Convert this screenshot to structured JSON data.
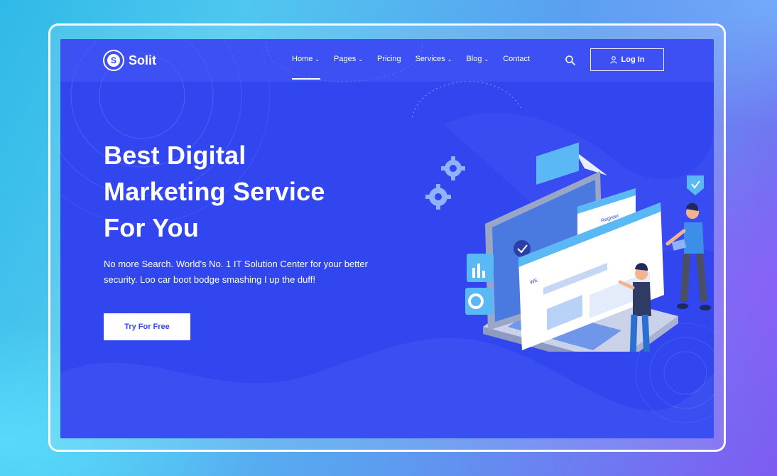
{
  "brand": {
    "name": "Solit",
    "logo_letter": "S"
  },
  "nav": {
    "items": [
      {
        "label": "Home",
        "dropdown": true,
        "active": true
      },
      {
        "label": "Pages",
        "dropdown": true,
        "active": false
      },
      {
        "label": "Pricing",
        "dropdown": false,
        "active": false
      },
      {
        "label": "Services",
        "dropdown": true,
        "active": false
      },
      {
        "label": "Blog",
        "dropdown": true,
        "active": false
      },
      {
        "label": "Contact",
        "dropdown": false,
        "active": false
      }
    ],
    "search_icon": "search-icon",
    "login_label": "Log In",
    "login_icon": "user-icon"
  },
  "hero": {
    "title_lines": [
      "Best Digital",
      "Marketing Service",
      "For You"
    ],
    "text": "No more Search. World's No. 1 IT Solution Center for your better security. Loo car boot bodge smashing I up the duff!",
    "cta_label": "Try For Free"
  },
  "illustration": {
    "sign_text": "Register",
    "panel_text": "WE"
  },
  "colors": {
    "primary": "#3246ef",
    "accent_light": "#5ab8f5",
    "white": "#ffffff"
  }
}
